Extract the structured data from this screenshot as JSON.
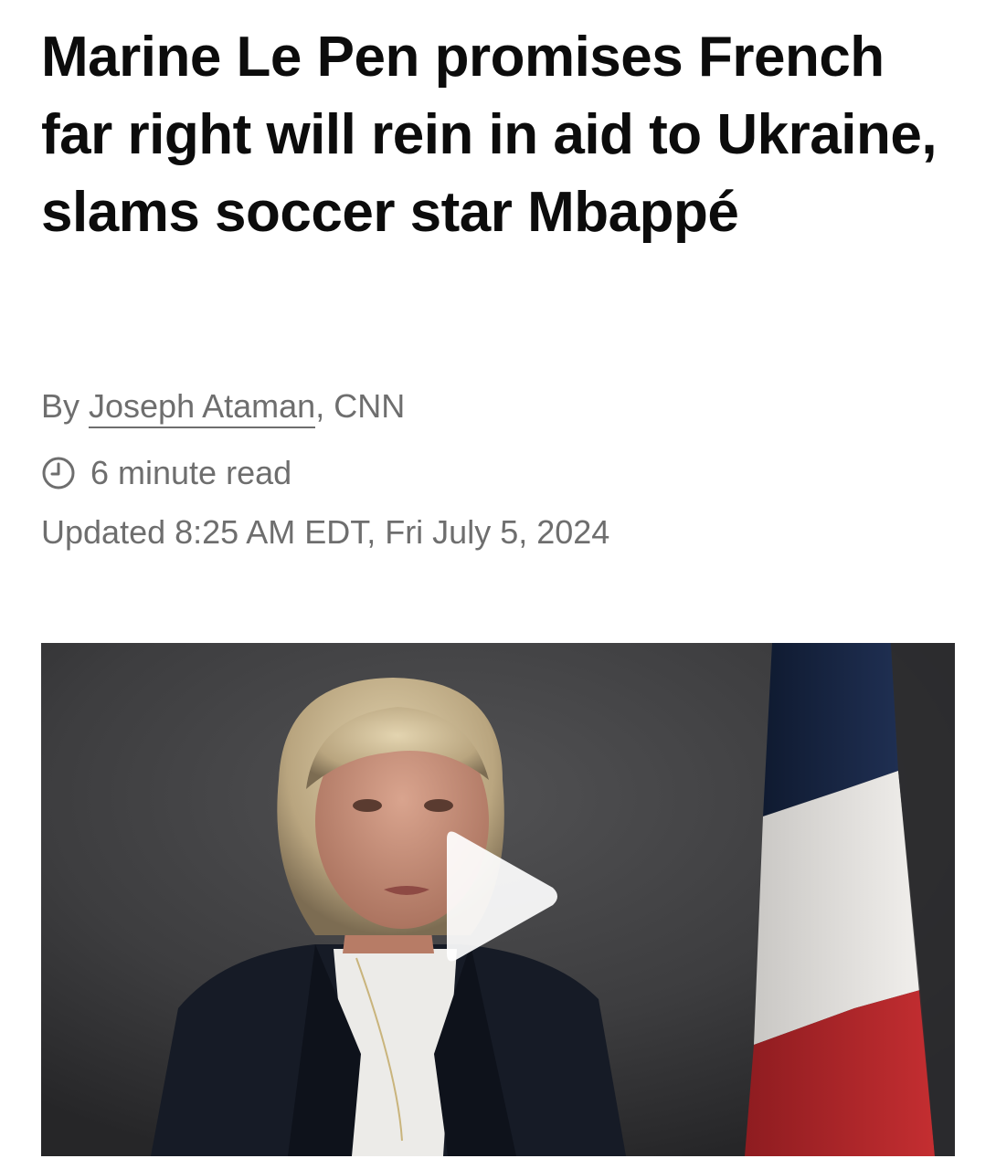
{
  "article": {
    "headline": "Marine Le Pen promises French far right will rein in aid to Ukraine, slams soccer star Mbappé",
    "byline_prefix": "By ",
    "author": "Joseph Ataman",
    "byline_suffix": ", CNN",
    "read_time": "6 minute read",
    "updated": "Updated 8:25 AM EDT, Fri July 5, 2024"
  },
  "video": {
    "icon": "play-icon",
    "colors": {
      "background": "#3d3d3f",
      "flag_blue": "#1b2a48",
      "flag_white": "#e8e6e3",
      "flag_red": "#b8282c"
    }
  },
  "colors": {
    "headline": "#0c0c0c",
    "meta_text": "#6e6e6e"
  }
}
